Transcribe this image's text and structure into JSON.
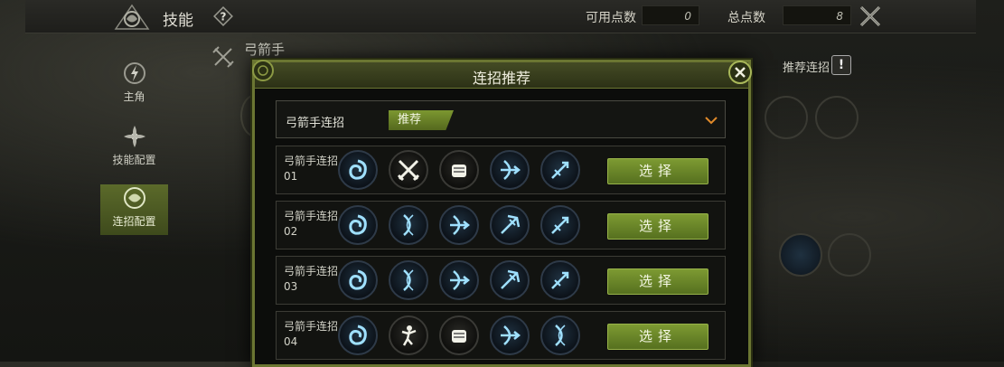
{
  "header": {
    "title": "技能",
    "available_points_label": "可用点数",
    "available_points_value": "0",
    "total_points_label": "总点数",
    "total_points_value": "8"
  },
  "nav": [
    {
      "label": "主角",
      "icon": "lightning-icon"
    },
    {
      "label": "技能配置",
      "icon": "shuriken-icon"
    },
    {
      "label": "连招配置",
      "icon": "swirl-icon",
      "active": true
    }
  ],
  "class_title": "弓箭手",
  "recommend_label": "推荐连招",
  "recommend_icon_text": "!",
  "modal": {
    "title": "连招推荐",
    "dropdown_label": "弓箭手连招",
    "dropdown_tag": "推荐",
    "select_label": "选择",
    "combos": [
      {
        "name": "弓箭手连招01",
        "skills": [
          "vortex",
          "crossed-swords",
          "fist",
          "bow-arrow",
          "aim-arrow"
        ]
      },
      {
        "name": "弓箭手连招02",
        "skills": [
          "vortex",
          "bow-ring",
          "bow-arrow",
          "spread-arrow",
          "aim-arrow"
        ]
      },
      {
        "name": "弓箭手连招03",
        "skills": [
          "vortex",
          "bow-ring",
          "bow-arrow",
          "spread-arrow",
          "aim-arrow"
        ]
      },
      {
        "name": "弓箭手连招04",
        "skills": [
          "vortex",
          "figure",
          "fist",
          "bow-arrow",
          "bow-ring"
        ]
      }
    ]
  },
  "colors": {
    "accent": "#7d9a32",
    "frame": "#6b7632",
    "skill_glow": "#7fd0ff"
  }
}
